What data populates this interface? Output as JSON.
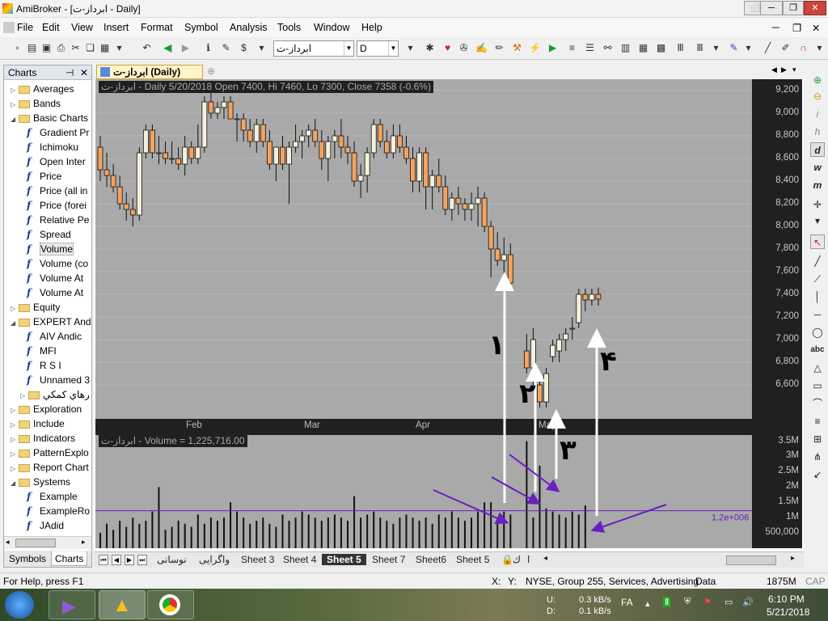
{
  "window": {
    "title": "AmiBroker - [ابرداز-ت - Daily]"
  },
  "menu": [
    "File",
    "Edit",
    "View",
    "Insert",
    "Format",
    "Symbol",
    "Analysis",
    "Tools",
    "Window",
    "Help"
  ],
  "toolbar": {
    "symbol": "ابرداز-ت",
    "interval": "D"
  },
  "sidebar": {
    "title": "Charts",
    "items": [
      {
        "type": "folder",
        "label": "Averages",
        "level": 0
      },
      {
        "type": "folder",
        "label": "Bands",
        "level": 0
      },
      {
        "type": "folder",
        "label": "Basic Charts",
        "level": 0,
        "open": true
      },
      {
        "type": "fn",
        "label": "Gradient Pr",
        "level": 1
      },
      {
        "type": "fn",
        "label": "Ichimoku",
        "level": 1
      },
      {
        "type": "fn",
        "label": "Open Inter",
        "level": 1
      },
      {
        "type": "fn",
        "label": "Price",
        "level": 1
      },
      {
        "type": "fn",
        "label": "Price (all in",
        "level": 1
      },
      {
        "type": "fn",
        "label": "Price (forei",
        "level": 1
      },
      {
        "type": "fn",
        "label": "Relative Pe",
        "level": 1
      },
      {
        "type": "fn",
        "label": "Spread",
        "level": 1
      },
      {
        "type": "fn",
        "label": "Volume",
        "level": 1,
        "selected": true
      },
      {
        "type": "fn",
        "label": "Volume (co",
        "level": 1
      },
      {
        "type": "fn",
        "label": "Volume At",
        "level": 1
      },
      {
        "type": "fn",
        "label": "Volume At",
        "level": 1
      },
      {
        "type": "folder",
        "label": "Equity",
        "level": 0
      },
      {
        "type": "folder",
        "label": "EXPERT And",
        "level": 0,
        "open": true
      },
      {
        "type": "fn",
        "label": "AIV Andic",
        "level": 1
      },
      {
        "type": "fn",
        "label": "MFI",
        "level": 1
      },
      {
        "type": "fn",
        "label": "R S I",
        "level": 1
      },
      {
        "type": "fn",
        "label": "Unnamed 3",
        "level": 1
      },
      {
        "type": "folder",
        "label": "ﺭﻫﺎﻱ ﻛﻤﻜﻲ",
        "level": 0.6
      },
      {
        "type": "folder",
        "label": "Exploration",
        "level": 0
      },
      {
        "type": "folder",
        "label": "Include",
        "level": 0
      },
      {
        "type": "folder",
        "label": "Indicators",
        "level": 0
      },
      {
        "type": "folder",
        "label": "PatternExplo",
        "level": 0
      },
      {
        "type": "folder",
        "label": "Report Chart",
        "level": 0
      },
      {
        "type": "folder",
        "label": "Systems",
        "level": 0,
        "open": true
      },
      {
        "type": "fn",
        "label": "Example",
        "level": 1
      },
      {
        "type": "fn",
        "label": "ExampleRo",
        "level": 1
      },
      {
        "type": "fn",
        "label": "JAdid",
        "level": 1
      }
    ],
    "tabs": [
      "Symbols",
      "Charts"
    ]
  },
  "chart_tab": "ابرداز-ت (Daily)",
  "price_info": "ابرداز-ت - Daily 5/20/2018 Open 7400, Hi 7460, Lo 7300, Close 7358 (-0.6%)",
  "volume_info": "ابرداز-ت - Volume = 1,225,716.00",
  "volume_line_label": "1.2e+006",
  "annotations": [
    "۱",
    "۲",
    "۳",
    "۴"
  ],
  "sheets": [
    "نوسانی",
    "واگرایی",
    "Sheet 3",
    "Sheet 4",
    "Sheet 5",
    "Sheet 7",
    "Sheet6",
    "Sheet 5"
  ],
  "active_sheet": "Sheet 5",
  "status": {
    "help": "For Help, press F1",
    "x": "X:",
    "y": "Y:",
    "market": "NYSE, Group 255, Services, Advertising",
    "data": "Data",
    "mem": "1875M",
    "cap": "CAP"
  },
  "tray": {
    "up": "U:",
    "down": "D:",
    "up_speed": "0.3 kB/s",
    "down_speed": "0.1 kB/s",
    "lang": "FA",
    "time": "6:10 PM",
    "date": "5/21/2018"
  },
  "colors": {
    "bull": "#f5f0dc",
    "bear": "#f2a360",
    "pane_bg": "#a9a9a9",
    "axis_bg": "#202020",
    "annotation": "#ffffff",
    "arrow": "#6a1fbf"
  },
  "chart_data": [
    {
      "type": "candlestick",
      "title": "ابرداز-ت - Daily",
      "x_labels": [
        "Feb",
        "Mar",
        "Apr",
        "May"
      ],
      "y_ticks": [
        6600,
        6800,
        7000,
        7200,
        7400,
        7600,
        7800,
        8000,
        8200,
        8400,
        8600,
        8800,
        9000,
        9200
      ],
      "ylim": [
        6300,
        9300
      ],
      "ohlc": [
        [
          8700,
          8800,
          8400,
          8500
        ],
        [
          8500,
          8650,
          8350,
          8450
        ],
        [
          8450,
          8550,
          8300,
          8350
        ],
        [
          8350,
          8450,
          8150,
          8200
        ],
        [
          8200,
          8300,
          8050,
          8150
        ],
        [
          8150,
          8250,
          8000,
          8100
        ],
        [
          8100,
          8700,
          8050,
          8650
        ],
        [
          8650,
          8900,
          8600,
          8850
        ],
        [
          8850,
          8900,
          8600,
          8650
        ],
        [
          8650,
          8800,
          8550,
          8650
        ],
        [
          8650,
          8750,
          8550,
          8600
        ],
        [
          8600,
          8750,
          8550,
          8600
        ],
        [
          8600,
          8700,
          8500,
          8550
        ],
        [
          8550,
          8800,
          8450,
          8700
        ],
        [
          8700,
          8750,
          8550,
          8600
        ],
        [
          8600,
          8900,
          8550,
          8700
        ],
        [
          8700,
          9150,
          8650,
          9100
        ],
        [
          9100,
          9200,
          8950,
          9000
        ],
        [
          9000,
          9100,
          8950,
          9050
        ],
        [
          9050,
          9150,
          8950,
          9100
        ],
        [
          9100,
          9150,
          8950,
          8950
        ],
        [
          8950,
          9000,
          8750,
          8950
        ],
        [
          8950,
          9000,
          8750,
          8850
        ],
        [
          8850,
          8950,
          8700,
          8750
        ],
        [
          8750,
          8950,
          8650,
          8900
        ],
        [
          8900,
          8950,
          8700,
          8750
        ],
        [
          8750,
          8850,
          8500,
          8550
        ],
        [
          8550,
          8700,
          8400,
          8700
        ],
        [
          8700,
          8800,
          8500,
          8550
        ],
        [
          8550,
          8750,
          8200,
          8700
        ],
        [
          8700,
          8900,
          8650,
          8750
        ],
        [
          8750,
          8850,
          8600,
          8800
        ],
        [
          8800,
          8900,
          8700,
          8850
        ],
        [
          8850,
          8950,
          8700,
          8750
        ],
        [
          8750,
          8850,
          8500,
          8600
        ],
        [
          8600,
          8800,
          8400,
          8750
        ],
        [
          8750,
          8850,
          8600,
          8800
        ],
        [
          8800,
          8950,
          8600,
          8700
        ],
        [
          8700,
          8800,
          8550,
          8650
        ],
        [
          8650,
          8750,
          8350,
          8400
        ],
        [
          8400,
          8550,
          8250,
          8450
        ],
        [
          8450,
          8700,
          8300,
          8650
        ],
        [
          8650,
          8950,
          8600,
          8900
        ],
        [
          8900,
          8950,
          8700,
          8750
        ],
        [
          8750,
          8850,
          8600,
          8650
        ],
        [
          8650,
          8900,
          8600,
          8800
        ],
        [
          8800,
          8900,
          8650,
          8700
        ],
        [
          8700,
          8800,
          8550,
          8600
        ],
        [
          8600,
          8700,
          8300,
          8400
        ],
        [
          8400,
          8700,
          8300,
          8650
        ],
        [
          8650,
          8700,
          8150,
          8350
        ],
        [
          8350,
          8500,
          8150,
          8450
        ],
        [
          8450,
          8600,
          8300,
          8350
        ],
        [
          8350,
          8450,
          8100,
          8150
        ],
        [
          8150,
          8300,
          8050,
          8250
        ],
        [
          8250,
          8350,
          8100,
          8200
        ],
        [
          8200,
          8250,
          8050,
          8150
        ],
        [
          8150,
          8300,
          8050,
          8200
        ],
        [
          8200,
          8350,
          8000,
          8250
        ],
        [
          8250,
          8300,
          7950,
          8000
        ],
        [
          8000,
          8050,
          7550,
          7800
        ],
        [
          7800,
          7950,
          7650,
          7700
        ],
        [
          7700,
          7900,
          7550,
          7750
        ],
        [
          7750,
          7850,
          7450,
          7500
        ],
        [
          6900,
          7050,
          6700,
          6750
        ],
        [
          6750,
          7100,
          6600,
          7000
        ],
        [
          6600,
          6700,
          6400,
          6450
        ],
        [
          6450,
          6750,
          6400,
          6700
        ],
        [
          6850,
          7000,
          6800,
          6950
        ],
        [
          6900,
          7050,
          6800,
          7000
        ],
        [
          7000,
          7100,
          6900,
          7050
        ],
        [
          7100,
          7200,
          7000,
          7100
        ],
        [
          7150,
          7450,
          7100,
          7400
        ],
        [
          7400,
          7450,
          7250,
          7350
        ],
        [
          7350,
          7450,
          7300,
          7400
        ],
        [
          7400,
          7460,
          7300,
          7358
        ]
      ]
    },
    {
      "type": "bar",
      "title": "ابرداز-ت - Volume",
      "y_ticks": [
        "500,000",
        "1M",
        "1.5M",
        "2M",
        "2.5M",
        "3M",
        "3.5M"
      ],
      "ylim": [
        0,
        3700000
      ],
      "values": [
        500000,
        800000,
        600000,
        900000,
        700000,
        1000000,
        800000,
        900000,
        1200000,
        2000000,
        600000,
        700000,
        900000,
        800000,
        700000,
        1100000,
        800000,
        1000000,
        900000,
        1000000,
        1500000,
        1200000,
        1000000,
        800000,
        900000,
        1000000,
        800000,
        700000,
        1100000,
        900000,
        1000000,
        1200000,
        1100000,
        1000000,
        900000,
        1000000,
        1100000,
        1000000,
        900000,
        1700000,
        1000000,
        1100000,
        1200000,
        1000000,
        900000,
        800000,
        1000000,
        1100000,
        1000000,
        900000,
        1000000,
        800000,
        1100000,
        1000000,
        1200000,
        1000000,
        900000,
        1000000,
        1200000,
        1500000,
        1500000,
        1000000,
        1200000,
        1100000,
        3500000,
        1000000,
        2700000,
        1300000,
        1200000,
        1100000,
        1000000,
        1200000,
        1100000,
        1400000
      ]
    }
  ]
}
